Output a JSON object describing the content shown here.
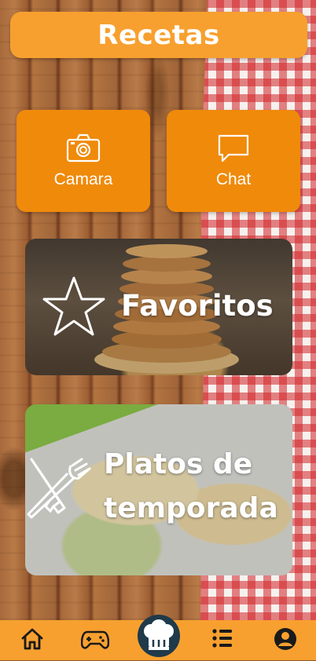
{
  "header": {
    "title": "Recetas"
  },
  "tiles": [
    {
      "label": "Camara",
      "icon": "camera-icon"
    },
    {
      "label": "Chat",
      "icon": "chat-bubble-icon"
    }
  ],
  "cards": [
    {
      "title": "Favoritos",
      "icon": "star-icon"
    },
    {
      "title_line1": "Platos de",
      "title_line2": "temporada",
      "icon": "knife-fork-icon"
    }
  ],
  "bottom_nav": {
    "items": [
      {
        "name": "home",
        "icon": "home-icon"
      },
      {
        "name": "games",
        "icon": "gamepad-icon"
      },
      {
        "name": "recipes",
        "icon": "chef-hat-icon",
        "active": true
      },
      {
        "name": "list",
        "icon": "list-icon"
      },
      {
        "name": "profile",
        "icon": "user-icon"
      }
    ]
  },
  "colors": {
    "accent": "#f7a02f",
    "tile": "#f08a0a",
    "nav_icon": "#1a1a1a",
    "chef_hat_bg": "#1f3a4a"
  }
}
